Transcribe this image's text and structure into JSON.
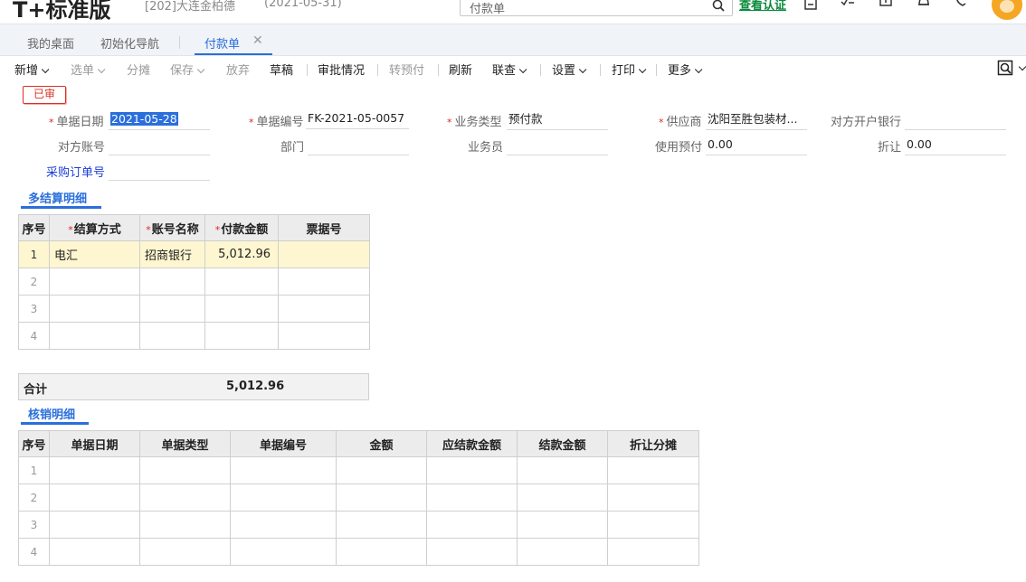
{
  "header": {
    "brand": "T+标准版",
    "account": "[202]大连金柏德",
    "account_date": "(2021-05-31)",
    "search_placeholder": "付款单",
    "verify_link": "查看认证"
  },
  "tabs": [
    {
      "label": "我的桌面"
    },
    {
      "label": "初始化导航"
    },
    {
      "label": "付款单",
      "active": true
    }
  ],
  "toolbar": {
    "new": "新增",
    "select": "选单",
    "split": "分摊",
    "save": "保存",
    "discard": "放弃",
    "draft": "草稿",
    "approval": "审批情况",
    "to_prepay": "转预付",
    "refresh": "刷新",
    "link_query": "联查",
    "settings": "设置",
    "print": "打印",
    "more": "更多"
  },
  "status_badge": "已审",
  "form": {
    "doc_date_label": "单据日期",
    "doc_date": "2021-05-28",
    "doc_no_label": "单据编号",
    "doc_no": "FK-2021-05-0057",
    "biz_type_label": "业务类型",
    "biz_type": "预付款",
    "supplier_label": "供应商",
    "supplier": "沈阳至胜包装材...",
    "counter_bank_label": "对方开户银行",
    "counter_bank": "",
    "counter_account_label": "对方账号",
    "counter_account": "",
    "dept_label": "部门",
    "dept": "",
    "salesman_label": "业务员",
    "salesman": "",
    "use_prepay_label": "使用预付",
    "use_prepay": "0.00",
    "discount_label": "折让",
    "discount": "0.00",
    "po_no_label": "采购订单号",
    "po_no": ""
  },
  "settlement": {
    "title": "多结算明细",
    "headers": [
      "序号",
      "结算方式",
      "账号名称",
      "付款金额",
      "票据号"
    ],
    "rows": [
      {
        "idx": "1",
        "method": "电汇",
        "account": "招商银行",
        "amount": "5,012.96",
        "bill": ""
      },
      {
        "idx": "2",
        "method": "",
        "account": "",
        "amount": "",
        "bill": ""
      },
      {
        "idx": "3",
        "method": "",
        "account": "",
        "amount": "",
        "bill": ""
      },
      {
        "idx": "4",
        "method": "",
        "account": "",
        "amount": "",
        "bill": ""
      }
    ],
    "total_label": "合计",
    "total_value": "5,012.96"
  },
  "writeoff": {
    "title": "核销明细",
    "headers": [
      "序号",
      "单据日期",
      "单据类型",
      "单据编号",
      "金额",
      "应结款金额",
      "结款金额",
      "折让分摊"
    ],
    "rows": [
      "1",
      "2",
      "3",
      "4"
    ]
  }
}
